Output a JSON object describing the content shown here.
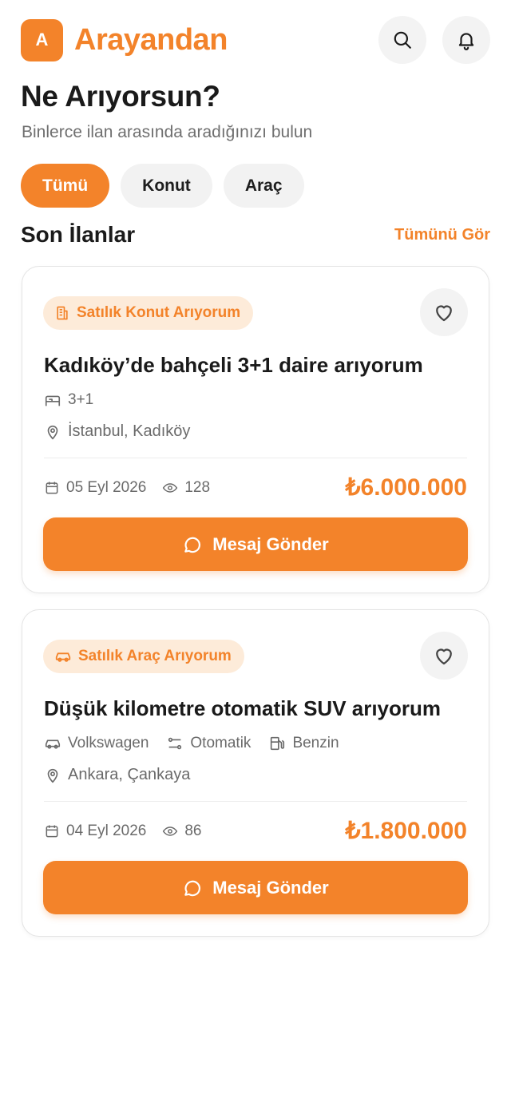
{
  "brand": {
    "logo_letter": "A",
    "name": "Arayandan",
    "accent": "#F3832A"
  },
  "hero": {
    "title": "Ne Arıyorsun?",
    "subtitle": "Binlerce ilan arasında aradığınızı bulun"
  },
  "filters": [
    {
      "label": "Tümü",
      "active": true
    },
    {
      "label": "Konut",
      "active": false
    },
    {
      "label": "Araç",
      "active": false
    }
  ],
  "section": {
    "title": "Son İlanlar",
    "see_all": "Tümünü Gör"
  },
  "listings": [
    {
      "tag": "Satılık Konut Arıyorum",
      "tag_icon": "building-icon",
      "title": "Kadıköy’de bahçeli 3+1 daire arıyorum",
      "specs": [
        {
          "icon": "bed-icon",
          "text": "3+1"
        }
      ],
      "location": "İstanbul, Kadıköy",
      "date": "05 Eyl 2026",
      "views": "128",
      "price": "₺6.000.000",
      "cta": "Mesaj Gönder"
    },
    {
      "tag": "Satılık Araç Arıyorum",
      "tag_icon": "car-icon",
      "title": "Düşük kilometre otomatik SUV arıyorum",
      "specs": [
        {
          "icon": "car-icon",
          "text": "Volkswagen"
        },
        {
          "icon": "gear-shift-icon",
          "text": "Otomatik"
        },
        {
          "icon": "fuel-icon",
          "text": "Benzin"
        }
      ],
      "location": "Ankara, Çankaya",
      "date": "04 Eyl 2026",
      "views": "86",
      "price": "₺1.800.000",
      "cta": "Mesaj Gönder"
    }
  ]
}
